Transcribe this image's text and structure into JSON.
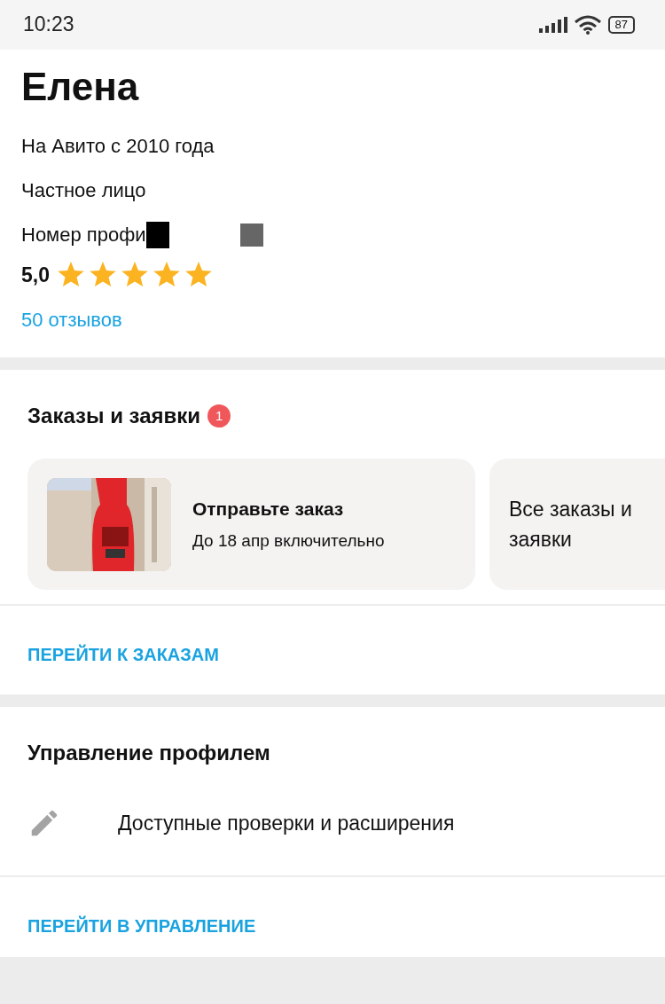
{
  "status_bar": {
    "time": "10:23",
    "battery": "87"
  },
  "profile": {
    "name": "Елена",
    "since": "На Авито с 2010 года",
    "type": "Частное лицо",
    "profile_number_label": "Номер профи",
    "rating": "5,0",
    "stars": 5,
    "reviews_link": "50 отзывов"
  },
  "orders": {
    "title": "Заказы и заявки",
    "badge": "1",
    "cards": [
      {
        "kind": "order",
        "title": "Отправьте заказ",
        "subtitle": "До 18 апр включительно"
      },
      {
        "kind": "link",
        "title": "Все заказы и заявки"
      }
    ],
    "link": "ПЕРЕЙТИ К ЗАКАЗАМ"
  },
  "management": {
    "title": "Управление профилем",
    "items": [
      {
        "label": "Доступные проверки и расширения"
      }
    ],
    "link": "ПЕРЕЙТИ В УПРАВЛЕНИЕ"
  }
}
